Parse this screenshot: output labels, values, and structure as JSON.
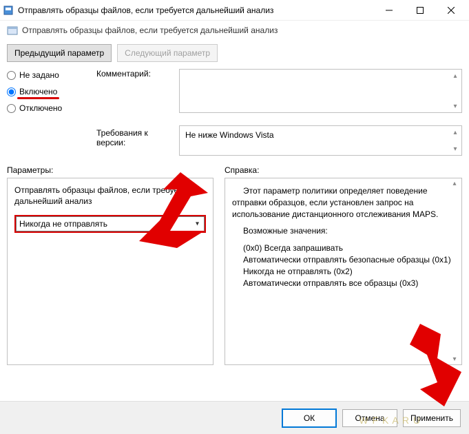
{
  "window": {
    "title": "Отправлять образцы файлов, если требуется дальнейший анализ"
  },
  "header": {
    "title": "Отправлять образцы файлов, если требуется дальнейший анализ"
  },
  "nav": {
    "prev": "Предыдущий параметр",
    "next": "Следующий параметр"
  },
  "radios": {
    "not_set": "Не задано",
    "enabled": "Включено",
    "disabled": "Отключено"
  },
  "labels": {
    "comment": "Комментарий:",
    "req": "Требования к версии:",
    "params": "Параметры:",
    "help": "Справка:"
  },
  "req_text": "Не ниже Windows Vista",
  "param_pane": {
    "desc": "Отправлять образцы файлов, если требуется дальнейший анализ",
    "selected": "Никогда не отправлять"
  },
  "help_pane": {
    "p1": "Этот параметр политики определяет поведение отправки образцов, если установлен запрос на использование дистанционного отслеживания MAPS.",
    "p2": "Возможные значения:",
    "v0": "(0x0) Всегда запрашивать",
    "v1": "Автоматически отправлять безопасные образцы (0x1)",
    "v2": "Никогда не отправлять (0x2)",
    "v3": "Автоматически отправлять все образцы (0x3)"
  },
  "buttons": {
    "ok": "ОК",
    "cancel": "Отмена",
    "apply": "Применить"
  },
  "watermark": "W F K A R U"
}
